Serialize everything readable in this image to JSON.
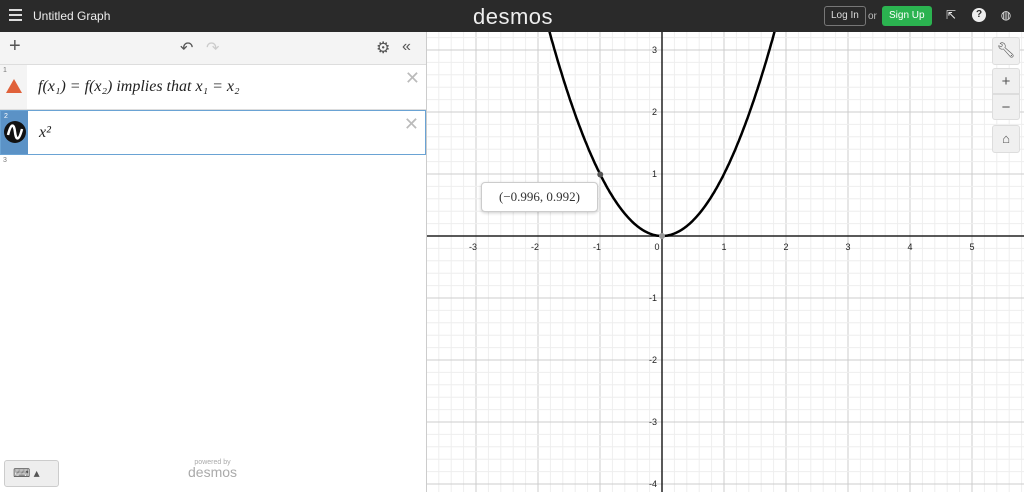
{
  "header": {
    "title": "Untitled Graph",
    "logo": "desmos",
    "login": "Log In",
    "or": "or",
    "signup": "Sign Up"
  },
  "expressions": [
    {
      "num": "1",
      "text": "f(x₁) = f(x₂) implies that x₁ = x₂",
      "icon": "warning-icon"
    },
    {
      "num": "2",
      "text": "x²",
      "icon": "wave-icon"
    },
    {
      "num": "3",
      "text": ""
    }
  ],
  "footer": {
    "powered": "powered by",
    "brand": "desmos"
  },
  "graph": {
    "x_ticks": [
      "-3",
      "-2",
      "-1",
      "0",
      "1",
      "2",
      "3",
      "4",
      "5"
    ],
    "y_ticks": [
      "3",
      "2",
      "1",
      "-1",
      "-2",
      "-3",
      "-4"
    ],
    "point_label": "(−0.996, 0.992)",
    "point": [
      -0.996,
      0.992
    ],
    "curve": "y=x^2",
    "accent": "#2bb350",
    "selected": "#5b92c6"
  }
}
